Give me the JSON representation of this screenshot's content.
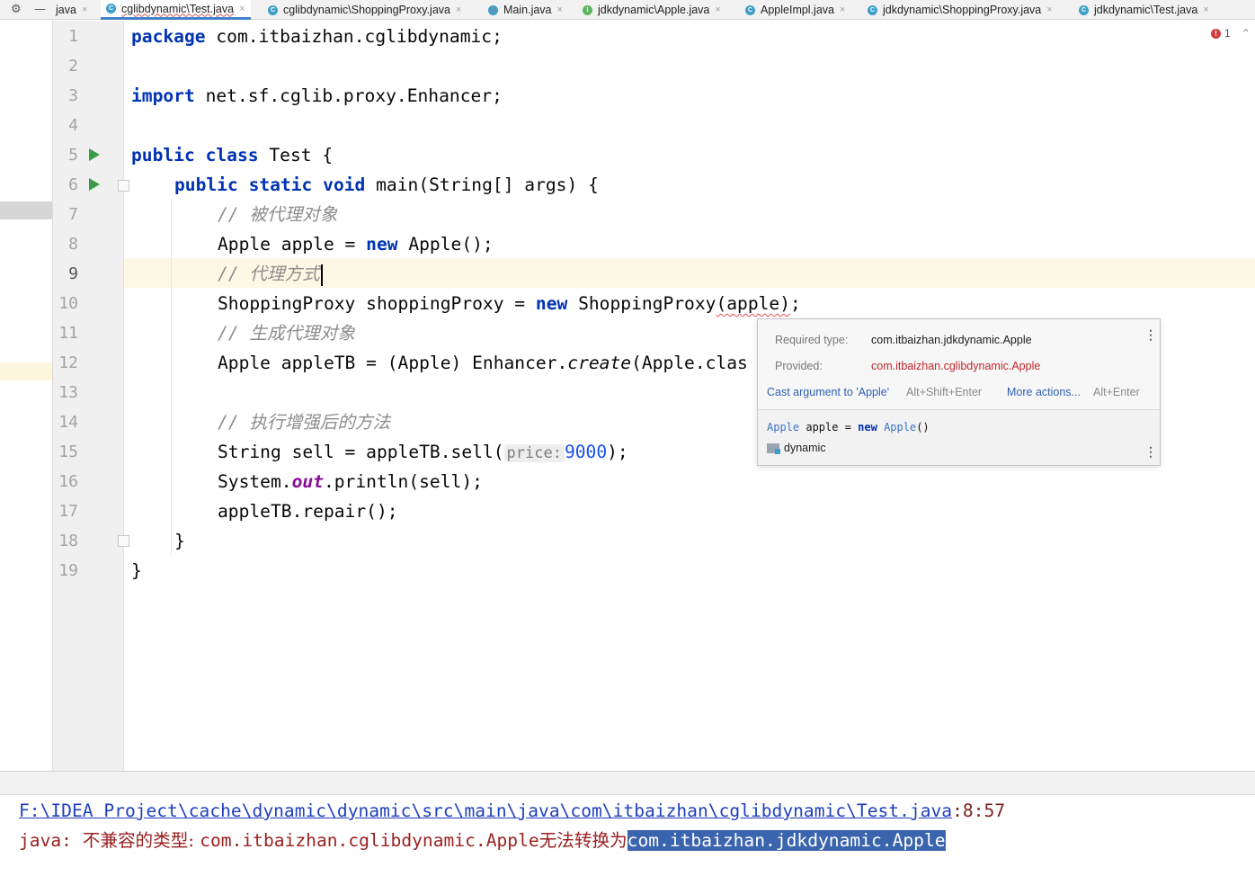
{
  "tabbar": {
    "settings_icon": "gear-icon",
    "minimize_icon": "minus-icon",
    "tabs": [
      {
        "label": "java",
        "icon": "",
        "active": false
      },
      {
        "label": "cglibdynamic\\Test.java",
        "icon": "class-icon",
        "active": true
      },
      {
        "label": "cglibdynamic\\ShoppingProxy.java",
        "icon": "class-icon",
        "active": false
      },
      {
        "label": "Main.java",
        "icon": "main-class-icon",
        "active": false
      },
      {
        "label": "jdkdynamic\\Apple.java",
        "icon": "interface-icon",
        "active": false
      },
      {
        "label": "AppleImpl.java",
        "icon": "class-icon",
        "active": false
      },
      {
        "label": "jdkdynamic\\ShoppingProxy.java",
        "icon": "class-icon",
        "active": false
      },
      {
        "label": "jdkdynamic\\Test.java",
        "icon": "class-icon",
        "active": false
      }
    ],
    "close_glyph": "×",
    "tab_icon_letters": {
      "class": "C",
      "interface": "I"
    }
  },
  "editor": {
    "line_numbers": [
      "1",
      "2",
      "3",
      "4",
      "5",
      "6",
      "7",
      "8",
      "9",
      "10",
      "11",
      "12",
      "13",
      "14",
      "15",
      "16",
      "17",
      "18",
      "19"
    ],
    "current_line": "9",
    "error_count": "1",
    "lines": {
      "l1": {
        "kw": "package",
        "rest": " com.itbaizhan.cglibdynamic;"
      },
      "l3": {
        "kw": "import",
        "rest": " net.sf.cglib.proxy.Enhancer;"
      },
      "l5": {
        "kw1": "public",
        "kw2": "class",
        "rest": " Test {"
      },
      "l6": {
        "kw1": "public",
        "kw2": "static",
        "kw3": "void",
        "rest": " main(String[] args) {"
      },
      "l7": {
        "comment": "// 被代理对象"
      },
      "l8": {
        "a": "Apple apple = ",
        "kw": "new",
        "b": " Apple();"
      },
      "l9": {
        "comment": "// 代理方式"
      },
      "l10": {
        "a": "ShoppingProxy shoppingProxy = ",
        "kw": "new",
        "b": " ShoppingProxy",
        "err": "(apple)",
        "c": ";"
      },
      "l11": {
        "comment": "// 生成代理对象"
      },
      "l12": {
        "a": "Apple appleTB = (Apple) Enhancer.",
        "it": "create",
        "b": "(Apple.clas"
      },
      "l14": {
        "comment": "// 执行增强后的方法"
      },
      "l15": {
        "a": "String sell = appleTB.sell(",
        "hint": "price:",
        "num": "9000",
        "b": ");"
      },
      "l16": {
        "a": "System.",
        "st": "out",
        "b": ".println(sell);"
      },
      "l17": {
        "a": "appleTB.repair();"
      },
      "l18": {
        "a": "}"
      },
      "l19": {
        "a": "}"
      }
    }
  },
  "popup": {
    "required_label": "Required type:",
    "required_value": "com.itbaizhan.jdkdynamic.Apple",
    "provided_label": "Provided:",
    "provided_value": "com.itbaizhan.cglibdynamic.Apple",
    "action1_label": "Cast argument to 'Apple'",
    "action1_shortcut": "Alt+Shift+Enter",
    "action2_label": "More actions...",
    "action2_shortcut": "Alt+Enter",
    "code_type": "Apple",
    "code_var": " apple = ",
    "code_kw": "new",
    "code_ctor": "Apple",
    "code_end": "()",
    "module_name": "dynamic",
    "kebab": "⋮"
  },
  "output": {
    "path": "F:\\IDEA Project\\cache\\dynamic\\dynamic\\src\\main\\java\\com\\itbaizhan\\cglibdynamic\\Test.java",
    "position": ":8:57",
    "err_prefix": "java: ",
    "err_cn1": "不兼容的类型: ",
    "err_type": "com.itbaizhan.cglibdynamic.Apple",
    "err_cn2": "无法转换为",
    "err_selected": "com.itbaizhan.jdkdynamic.Apple"
  },
  "colors": {
    "keyword": "#0033b3",
    "comment": "#8c8c8c",
    "number": "#1750eb",
    "static_field": "#871094",
    "error": "#c1272d",
    "link": "#1f3fbf",
    "selection": "#3a64ad",
    "current_line": "#fcf8e5"
  }
}
